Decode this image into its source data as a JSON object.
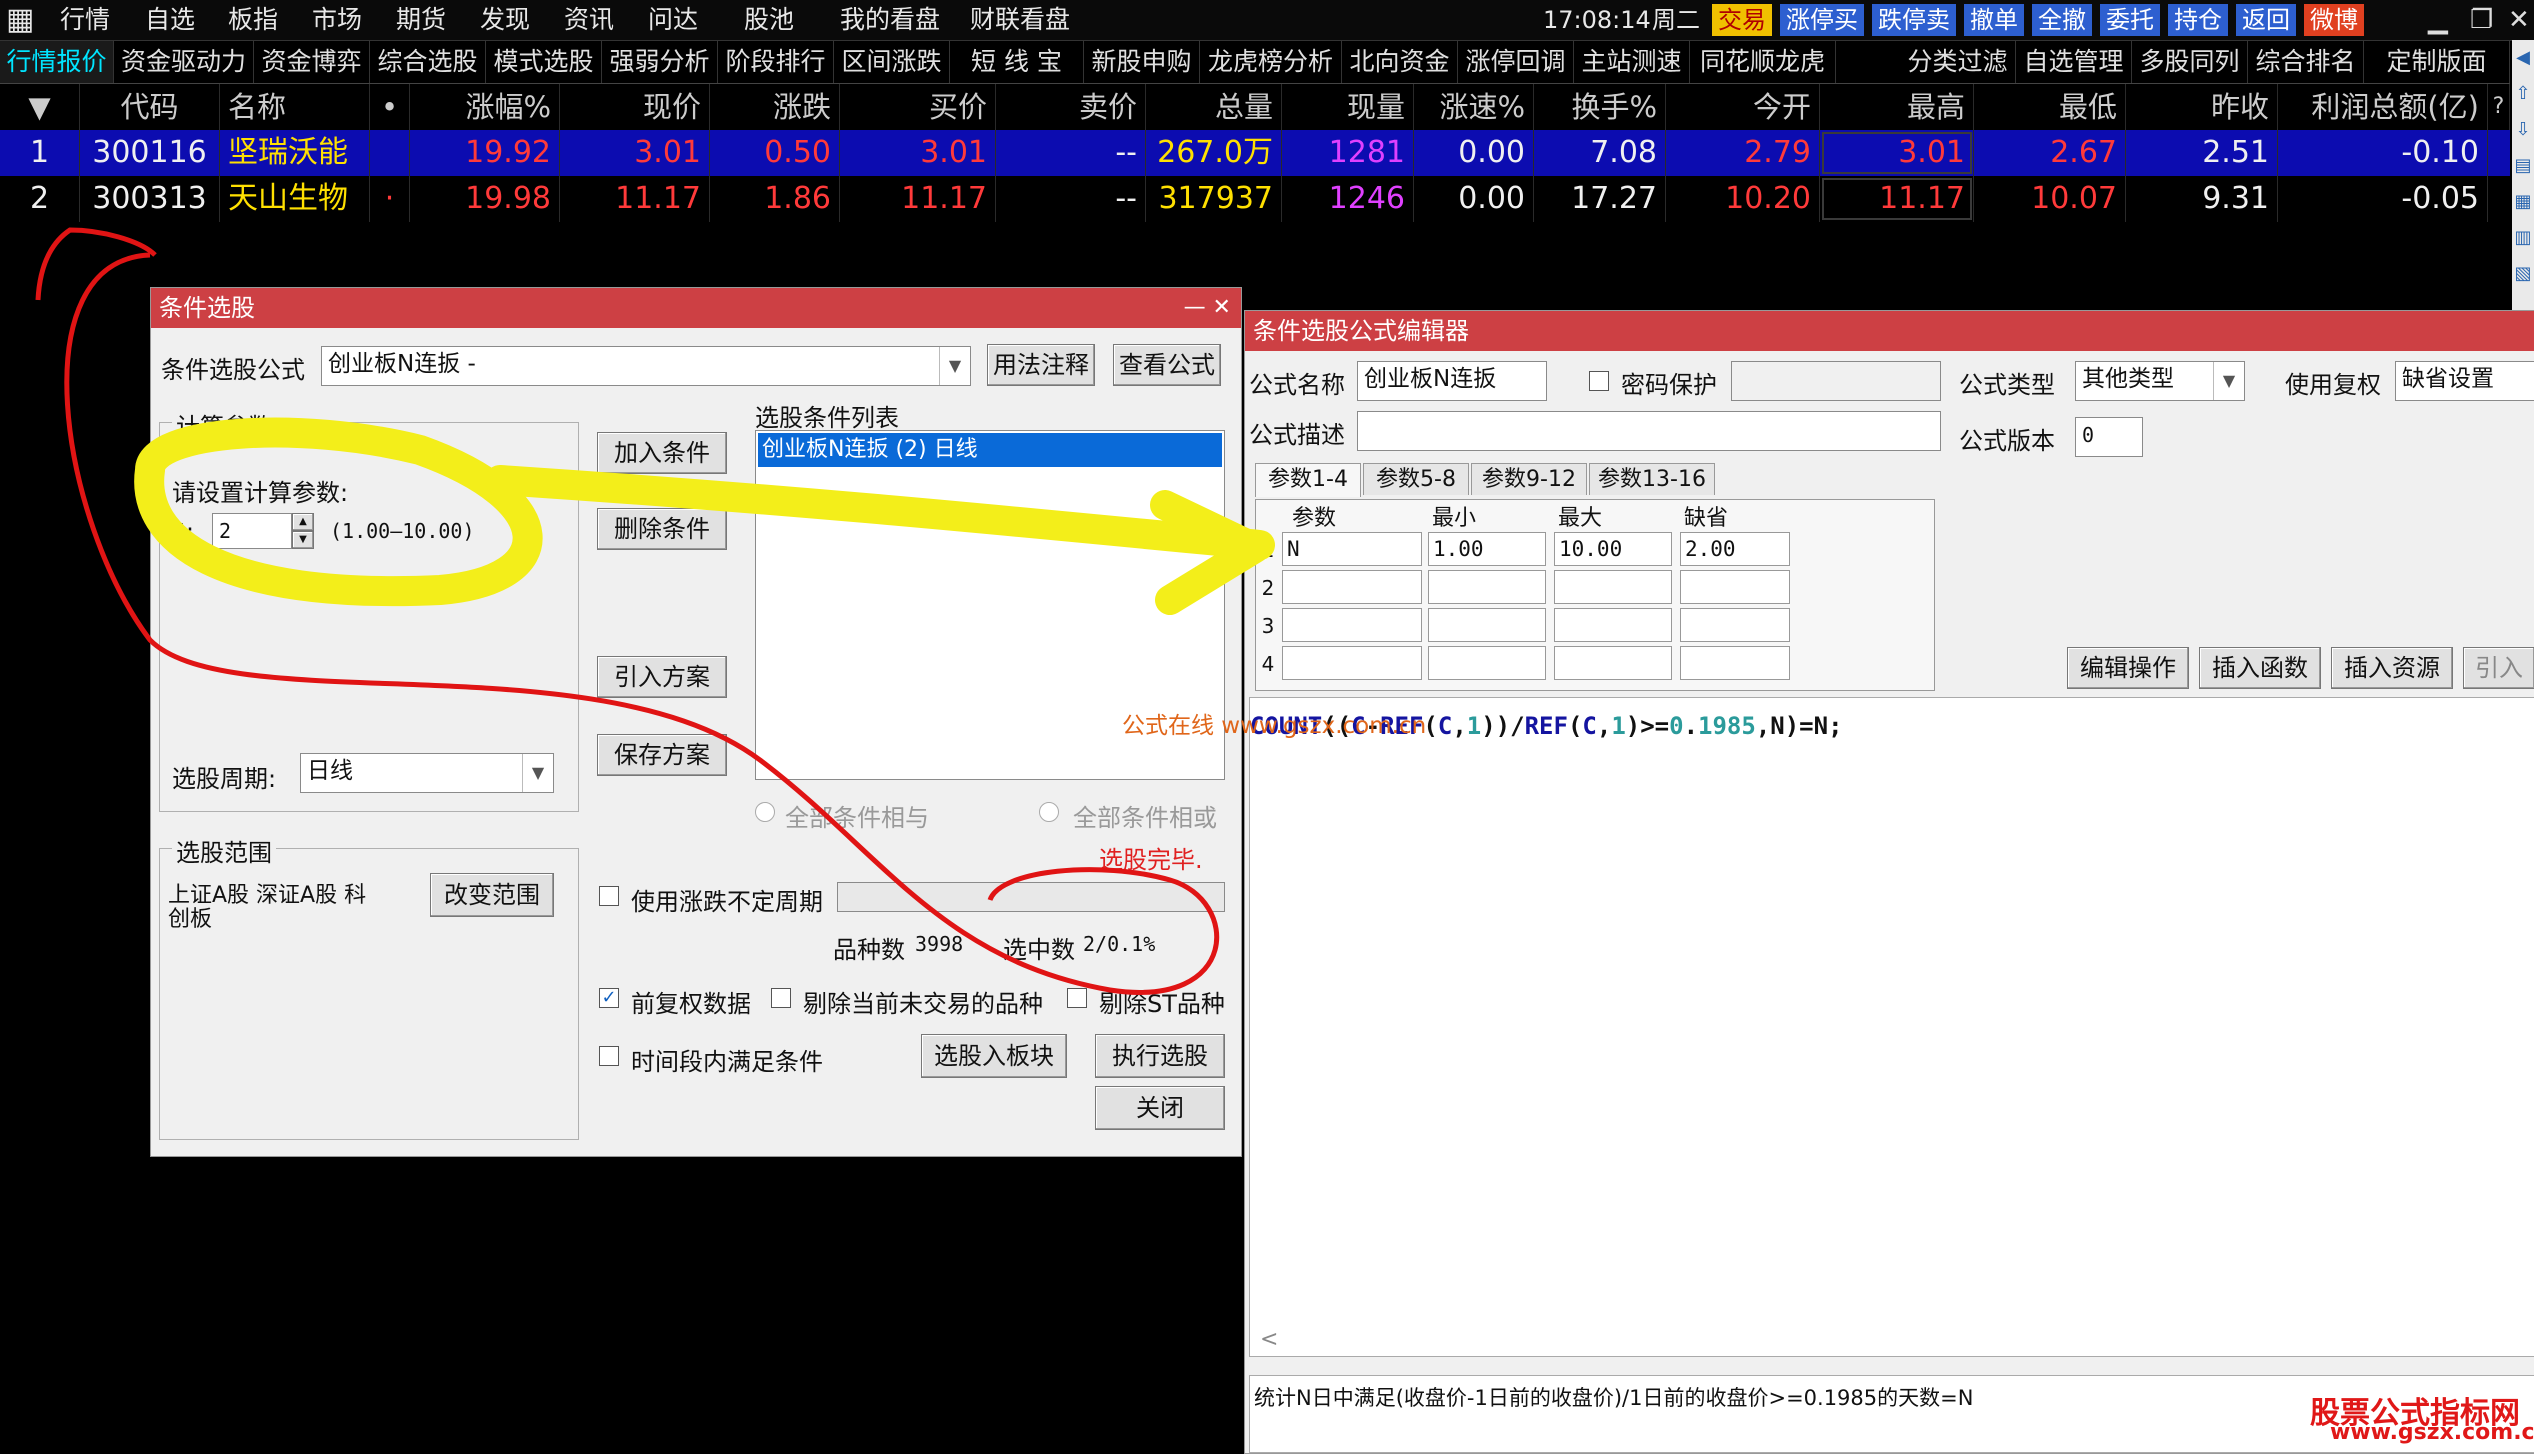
{
  "topbar": {
    "menu": [
      "行情",
      "自选",
      "板指",
      "市场",
      "期货",
      "发现",
      "资讯",
      "问达",
      "股池",
      "我的看盘",
      "财联看盘"
    ],
    "clock": "17:08:14",
    "weekday": "周二",
    "sys_buttons": [
      {
        "label": "交易",
        "bg": "#f0c000",
        "fg": "#b00000"
      },
      {
        "label": "涨停买",
        "bg": "#2d5fd0",
        "fg": "#ffffff"
      },
      {
        "label": "跌停卖",
        "bg": "#2d5fd0",
        "fg": "#ffffff"
      },
      {
        "label": "撤单",
        "bg": "#2d5fd0",
        "fg": "#ffffff"
      },
      {
        "label": "全撤",
        "bg": "#2d5fd0",
        "fg": "#ffffff"
      },
      {
        "label": "委托",
        "bg": "#2d5fd0",
        "fg": "#ffffff"
      },
      {
        "label": "持仓",
        "bg": "#2d5fd0",
        "fg": "#ffffff"
      },
      {
        "label": "返回",
        "bg": "#2d5fd0",
        "fg": "#ffffff"
      },
      {
        "label": "微博",
        "bg": "#e04020",
        "fg": "#ffffff"
      }
    ],
    "window_controls": [
      "▁",
      "❐",
      "✕"
    ]
  },
  "nav": {
    "items": [
      "行情报价",
      "资金驱动力",
      "资金博弈",
      "综合选股",
      "模式选股",
      "强弱分析",
      "阶段排行",
      "区间涨跌",
      "短 线 宝",
      "新股申购",
      "龙虎榜分析",
      "北向资金",
      "涨停回调",
      "主站测速",
      "同花顺龙虎"
    ],
    "right_items": [
      "分类过滤",
      "自选管理",
      "多股同列",
      "综合排名",
      "定制版面"
    ]
  },
  "quote": {
    "headers": [
      "▼",
      "代码",
      "名称",
      "•",
      "涨幅%",
      "现价",
      "涨跌",
      "买价",
      "卖价",
      "总量",
      "现量",
      "涨速%",
      "换手%",
      "今开",
      "最高",
      "最低",
      "昨收",
      "利润总额(亿)",
      "?"
    ],
    "rows": [
      {
        "idx": "1",
        "code": "300116",
        "name": "坚瑞沃能",
        "mark": "",
        "pct": "19.92",
        "price": "3.01",
        "chg": "0.50",
        "bid": "3.01",
        "ask": "--",
        "vol": "267.0万",
        "cur": "1281",
        "speed": "0.00",
        "turn": "7.08",
        "open": "2.79",
        "high": "3.01",
        "low": "2.67",
        "prev": "2.51",
        "profit": "-0.10"
      },
      {
        "idx": "2",
        "code": "300313",
        "name": "天山生物",
        "mark": "·",
        "pct": "19.98",
        "price": "11.17",
        "chg": "1.86",
        "bid": "11.17",
        "ask": "--",
        "vol": "317937",
        "cur": "1246",
        "speed": "0.00",
        "turn": "17.27",
        "open": "10.20",
        "high": "11.17",
        "low": "10.07",
        "prev": "9.31",
        "profit": "-0.05"
      }
    ]
  },
  "picker": {
    "title": "条件选股",
    "close": "—  ✕",
    "formula_label": "条件选股公式",
    "formula_value": "创业板N连扳  -",
    "btn_usage": "用法注释",
    "btn_view": "查看公式",
    "params_group": "计算参数",
    "params_prompt": "请设置计算参数:",
    "param_name": "N:",
    "param_value": "2",
    "param_range": "(1.00—10.00)",
    "cond_list_label": "选股条件列表",
    "cond_items": [
      "创业板N连扳 (2) 日线"
    ],
    "btn_add": "加入条件",
    "btn_del": "删除条件",
    "btn_import": "引入方案",
    "btn_save": "保存方案",
    "period_label": "选股周期:",
    "period_value": "日线",
    "radio_and": "全部条件相与",
    "radio_or": "全部条件相或",
    "scope_group": "选股范围",
    "scope_text_1": "上证A股 深证A股 科",
    "scope_text_2": "创板",
    "btn_scope": "改变范围",
    "status": "选股完毕.",
    "chk_variable_period": "使用涨跌不定周期",
    "count_label": "品种数",
    "count_value": "3998",
    "selected_label": "选中数",
    "selected_value": "2/0.1%",
    "chk_adjust": "前复权数据",
    "chk_exclude_untraded": "剔除当前未交易的品种",
    "chk_exclude_st": "剔除ST品种",
    "chk_time_range": "时间段内满足条件",
    "btn_to_block": "选股入板块",
    "btn_execute": "执行选股",
    "btn_close": "关闭"
  },
  "editor": {
    "title": "条件选股公式编辑器",
    "name_label": "公式名称",
    "name_value": "创业板N连扳",
    "pwd_label": "密码保护",
    "type_label": "公式类型",
    "type_value": "其他类型",
    "adjust_label": "使用复权",
    "adjust_value": "缺省设置",
    "desc_label": "公式描述",
    "version_label": "公式版本",
    "version_value": "0",
    "tabs": [
      "参数1-4",
      "参数5-8",
      "参数9-12",
      "参数13-16"
    ],
    "grid_headers": [
      "参数",
      "最小",
      "最大",
      "缺省"
    ],
    "grid_rows": [
      {
        "n": "1",
        "name": "N",
        "min": "1.00",
        "max": "10.00",
        "def": "2.00"
      },
      {
        "n": "2",
        "name": "",
        "min": "",
        "max": "",
        "def": ""
      },
      {
        "n": "3",
        "name": "",
        "min": "",
        "max": "",
        "def": ""
      },
      {
        "n": "4",
        "name": "",
        "min": "",
        "max": "",
        "def": ""
      }
    ],
    "btn_edit": "编辑操作",
    "btn_insert_fn": "插入函数",
    "btn_insert_res": "插入资源",
    "btn_import": "引入公",
    "code_parts": [
      {
        "t": "COUNT",
        "c": "kw"
      },
      {
        "t": "((",
        "c": "op"
      },
      {
        "t": "C",
        "c": "kw"
      },
      {
        "t": "-",
        "c": "op"
      },
      {
        "t": "REF",
        "c": "kw"
      },
      {
        "t": "(",
        "c": "op"
      },
      {
        "t": "C",
        "c": "kw"
      },
      {
        "t": ",",
        "c": "op"
      },
      {
        "t": "1",
        "c": "num"
      },
      {
        "t": "))/",
        "c": "op"
      },
      {
        "t": "REF",
        "c": "kw"
      },
      {
        "t": "(",
        "c": "op"
      },
      {
        "t": "C",
        "c": "kw"
      },
      {
        "t": ",",
        "c": "op"
      },
      {
        "t": "1",
        "c": "num"
      },
      {
        "t": ")>=",
        "c": "op"
      },
      {
        "t": "0",
        "c": "num"
      },
      {
        "t": ".",
        "c": "op"
      },
      {
        "t": "1985",
        "c": "num"
      },
      {
        "t": ",N)=N;",
        "c": "op"
      }
    ],
    "hint": "统计N日中满足(收盘价-1日前的收盘价)/1日前的收盘价>=0.1985的天数=N",
    "scroll_left": "<"
  },
  "watermarks": {
    "center": "公式在线 www.gszx.com.cn",
    "corner_title": "股票公式指标网",
    "corner_url": "www.gszx.com.cn"
  },
  "side_icons": [
    "◀",
    "⇧",
    "⇩",
    "▤",
    "▦",
    "▥",
    "▧"
  ]
}
